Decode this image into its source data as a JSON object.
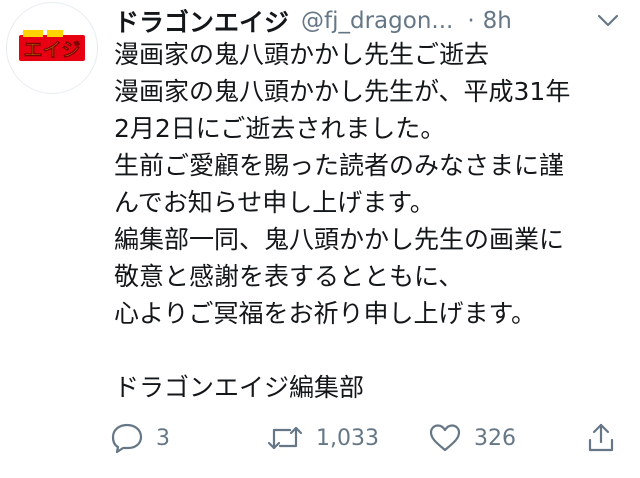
{
  "tweet": {
    "display_name": "ドラゴンエイジ",
    "handle": "@fj_dragon...",
    "separator": "·",
    "time": "8h",
    "avatar_logo_text": "エイジ",
    "lines": [
      "漫画家の鬼八頭かかし先生ご逝去",
      "漫画家の鬼八頭かかし先生が、平成31年",
      "2月2日にご逝去されました。",
      "生前ご愛顧を賜った読者のみなさまに謹",
      "んでお知らせ申し上げます。",
      "編集部一同、鬼八頭かかし先生の画業に",
      "敬意と感謝を表するとともに、",
      "心よりご冥福をお祈り申し上げます。",
      "",
      "ドラゴンエイジ編集部"
    ],
    "actions": {
      "replies": "3",
      "retweets": "1,033",
      "likes": "326"
    },
    "icons": {
      "menu": "chevron-down-icon",
      "reply": "reply-icon",
      "retweet": "retweet-icon",
      "like": "heart-icon",
      "share": "share-icon"
    },
    "colors": {
      "text": "#14171a",
      "secondary": "#657786",
      "logo_red": "#e60012",
      "logo_yellow": "#ffd400"
    }
  }
}
